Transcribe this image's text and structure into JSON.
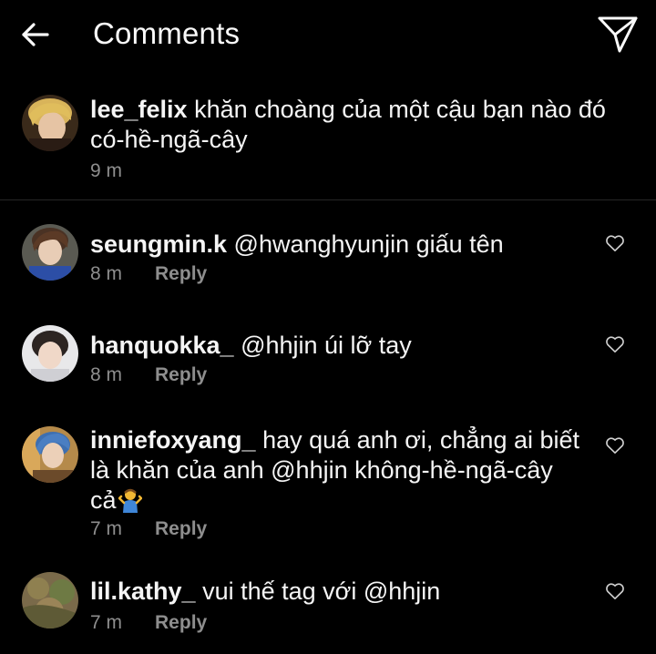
{
  "header": {
    "title": "Comments",
    "back_icon": "arrow-left-icon",
    "send_icon": "paper-plane-icon"
  },
  "caption": {
    "username": "lee_felix",
    "text_line1": "khăn choàng của một cậu bạn nào đó",
    "text_line2": "có-hề-ngã-cây",
    "time": "9 m"
  },
  "comments": [
    {
      "username": "seungmin.k",
      "text": "@hwanghyunjin giấu tên",
      "time": "8 m",
      "reply_label": "Reply"
    },
    {
      "username": "hanquokka_",
      "text": "@hhjin úi lỡ tay",
      "time": "8 m",
      "reply_label": "Reply"
    },
    {
      "username": "inniefoxyang_",
      "text_line1": "hay quá anh ơi, chẳng ai biết",
      "text_line2": "là khăn của anh @hhjin không-hề-ngã-cây",
      "text_line3": "cả",
      "emoji": "person-shrugging-emoji",
      "time": "7 m",
      "reply_label": "Reply"
    },
    {
      "username": "lil.kathy_",
      "text": "vui thế tag với @hhjin",
      "time": "7 m",
      "reply_label": "Reply"
    }
  ],
  "colors": {
    "background": "#000000",
    "text": "#f5f5f5",
    "muted": "#8e8e8e",
    "divider": "#262626"
  }
}
